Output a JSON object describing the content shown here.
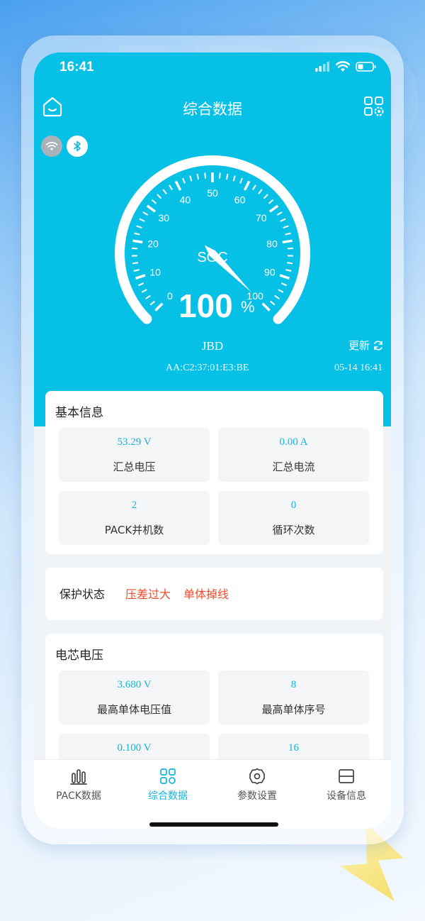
{
  "status_bar": {
    "time": "16:41"
  },
  "header": {
    "title": "综合数据"
  },
  "gauge": {
    "label": "SOC",
    "soc_value": 100,
    "soc_display": "100",
    "unit": "%",
    "ticks": [
      "0",
      "10",
      "20",
      "30",
      "40",
      "50",
      "60",
      "70",
      "80",
      "90",
      "100"
    ]
  },
  "device": {
    "name": "JBD",
    "update_label": "更新",
    "mac": "AA:C2:37:01:E3:BE",
    "timestamp": "05-14 16:41"
  },
  "basic_info": {
    "title": "基本信息",
    "items": [
      {
        "value": "53.29 V",
        "label": "汇总电压"
      },
      {
        "value": "0.00 A",
        "label": "汇总电流"
      },
      {
        "value": "2",
        "label": "PACK并机数"
      },
      {
        "value": "0",
        "label": "循环次数"
      }
    ]
  },
  "protection": {
    "label": "保护状态",
    "tags": [
      "压差过大",
      "单体掉线"
    ]
  },
  "cell_voltage": {
    "title": "电芯电压",
    "items": [
      {
        "value": "3.680 V",
        "label": "最高单体电压值"
      },
      {
        "value": "8",
        "label": "最高单体序号"
      },
      {
        "value": "0.100 V",
        "label": ""
      },
      {
        "value": "16",
        "label": ""
      }
    ]
  },
  "tabbar": {
    "tabs": [
      {
        "label": "PACK数据",
        "icon": "bar-chart-icon"
      },
      {
        "label": "综合数据",
        "icon": "grid-icon"
      },
      {
        "label": "参数设置",
        "icon": "gear-icon"
      },
      {
        "label": "设备信息",
        "icon": "device-info-icon"
      }
    ],
    "active_index": 1
  },
  "colors": {
    "primary": "#07c0e6",
    "value_text": "#14b4dc",
    "warning": "#f04d2b"
  }
}
